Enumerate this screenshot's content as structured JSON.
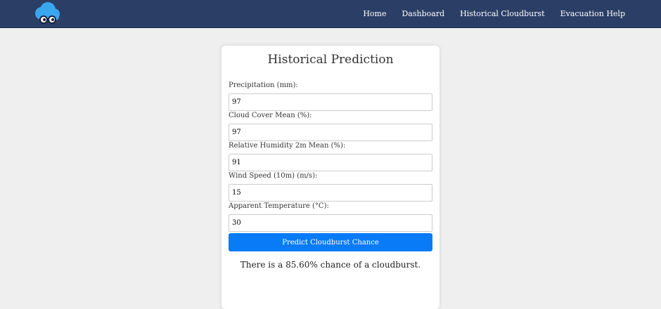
{
  "nav": {
    "logo": "cloud-logo-icon",
    "links": [
      "Home",
      "Dashboard",
      "Historical Cloudburst",
      "Evacuation Help"
    ]
  },
  "card": {
    "title": "Historical Prediction",
    "fields": [
      {
        "label": "Precipitation (mm):",
        "value": "97"
      },
      {
        "label": "Cloud Cover Mean (%):",
        "value": "97"
      },
      {
        "label": "Relative Humidity 2m Mean (%):",
        "value": "91"
      },
      {
        "label": "Wind Speed (10m) (m/s):",
        "value": "15"
      },
      {
        "label": "Apparent Temperature (°C):",
        "value": "30"
      }
    ],
    "button_label": "Predict Cloudburst Chance",
    "result": "There is a 85.60% chance of a cloudburst."
  },
  "colors": {
    "navbar": "#2b3f66",
    "background": "#efefef",
    "button": "#0a7bf7",
    "logo_blue": "#3aa6ee"
  }
}
